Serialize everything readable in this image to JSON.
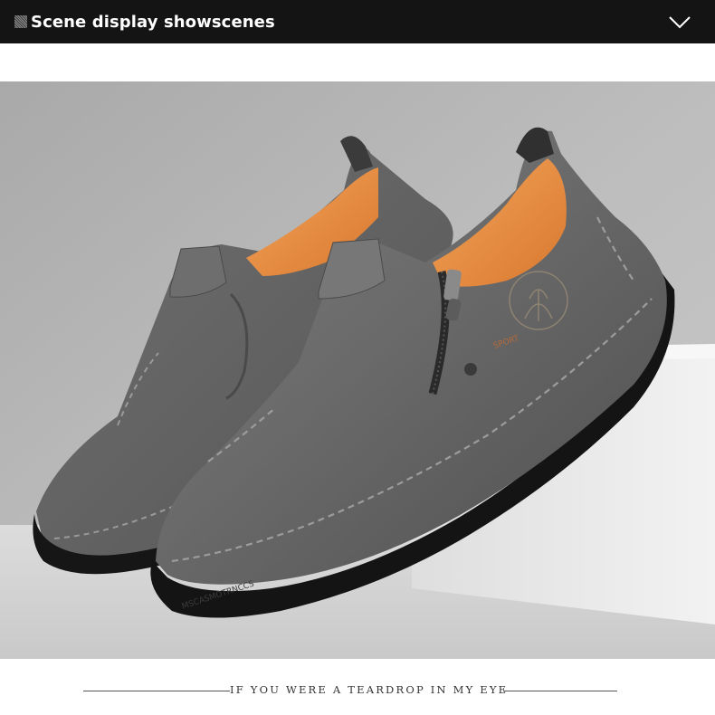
{
  "header": {
    "title": "Scene display showscenes",
    "toggle_icon": "chevron-down-icon",
    "background": "#141414"
  },
  "scene": {
    "image_subject": "pair of grey leather slip-on loafers with side zipper",
    "sole_text": "MSCASMOTRNCCS",
    "tongue_logo_text": "SPORT"
  },
  "footer": {
    "tagline": "IF YOU WERE A TEARDROP IN MY EYE"
  }
}
